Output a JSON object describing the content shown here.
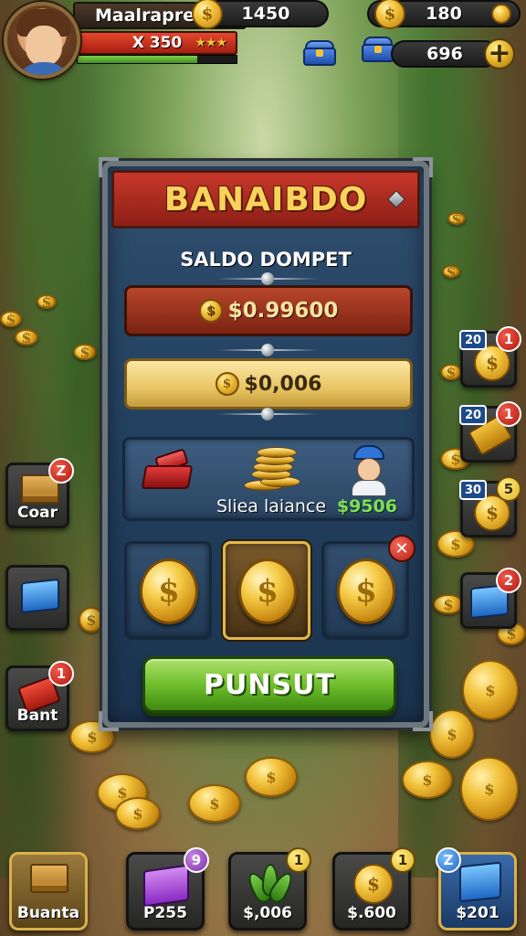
{
  "player": {
    "name": "Maalrapret",
    "hp_text": "X 350",
    "stars": "★★★",
    "xp_progress": 0.75
  },
  "currency": {
    "coins": "1450",
    "gold": "180",
    "gems": "696",
    "coin_symbol": "$",
    "plus": "+"
  },
  "modal": {
    "title": "BANAIBDO",
    "subtitle": "SALDO DOMPET",
    "balance_red": "$0.99600",
    "balance_gold": "$0,006",
    "info_label": "Sliea laiance",
    "info_value": "$9506",
    "close_symbol": "✕",
    "cta_label": "PUNSUT"
  },
  "side_left": [
    {
      "label": "Coar",
      "badge": "Z"
    },
    {
      "label": "",
      "badge": ""
    },
    {
      "label": "Bant",
      "badge": "1"
    }
  ],
  "side_right": [
    {
      "count": "20",
      "badge": "1"
    },
    {
      "count": "20",
      "badge": "1"
    },
    {
      "count": "30",
      "badge": "5"
    },
    {
      "count": "",
      "badge": "2"
    }
  ],
  "bottom_bar": [
    {
      "label": "Buanta",
      "badge": ""
    },
    {
      "label": "P255",
      "badge": "9"
    },
    {
      "label": "$,006",
      "badge": "1"
    },
    {
      "label": "$.600",
      "badge": "1"
    },
    {
      "label": "$201",
      "badge": "Z"
    }
  ],
  "colors": {
    "header_red": "#c8372a",
    "title_gold": "#f8d25a",
    "cta_green": "#6fbf2c",
    "panel_blue": "#22405f",
    "value_green": "#7ee05a"
  }
}
